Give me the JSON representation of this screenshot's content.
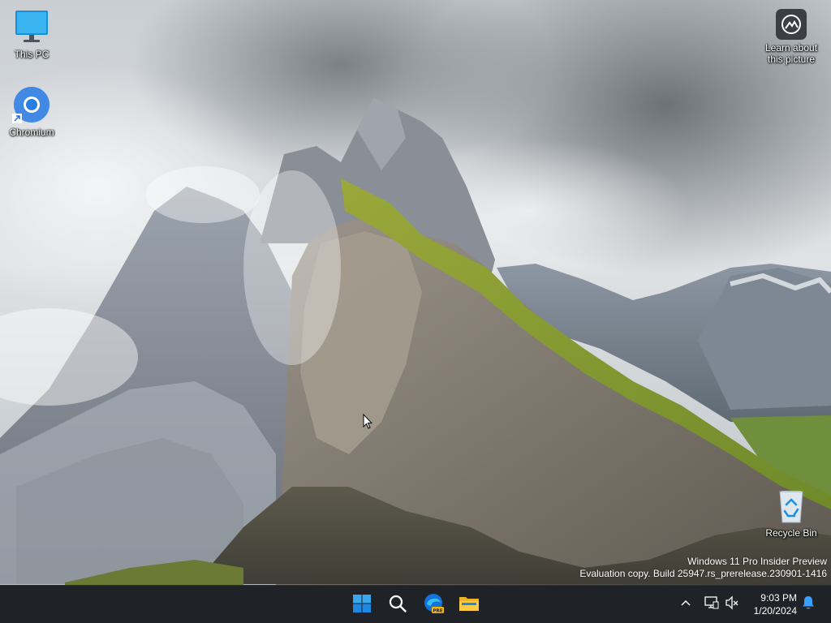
{
  "desktop": {
    "icons": [
      {
        "label": "This PC",
        "icon": "monitor-icon"
      },
      {
        "label": "Chromium",
        "icon": "chromium-icon"
      },
      {
        "label": "Recycle Bin",
        "icon": "recycle-bin-icon"
      }
    ],
    "spotlight": {
      "label_line1": "Learn about",
      "label_line2": "this picture",
      "icon": "camera-icon"
    }
  },
  "watermark": {
    "line1": "Windows 11 Pro Insider Preview",
    "line2": "Evaluation copy. Build 25947.rs_prerelease.230901-1416"
  },
  "taskbar": {
    "apps": [
      {
        "name": "Start",
        "icon": "windows-start-icon"
      },
      {
        "name": "Search",
        "icon": "search-icon"
      },
      {
        "name": "Edge Canary",
        "icon": "edge-pre-icon",
        "badge": "PRE"
      },
      {
        "name": "File Explorer",
        "icon": "folder-icon"
      }
    ],
    "tray": {
      "overflow_icon": "chevron-up-icon",
      "network_icon": "network-icon",
      "volume_icon": "volume-muted-icon",
      "notification_icon": "bell-icon"
    },
    "clock": {
      "time": "9:03 PM",
      "date": "1/20/2024"
    }
  },
  "colors": {
    "taskbar_bg": "#1f2226",
    "windows_blue": "#0b7ddb",
    "bell_blue": "#3aa0ff"
  }
}
